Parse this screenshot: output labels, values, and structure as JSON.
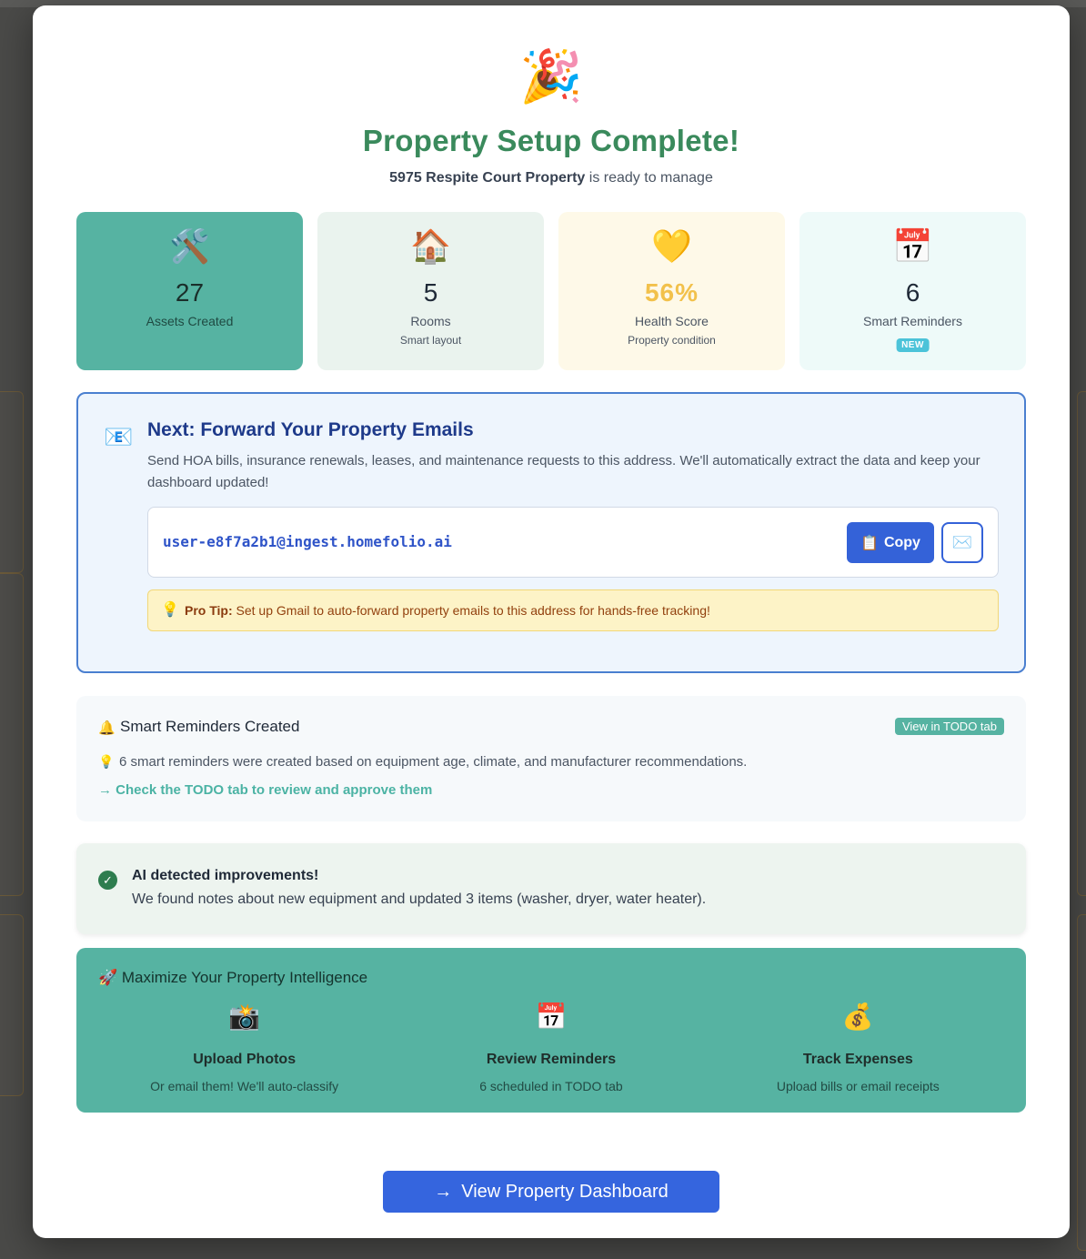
{
  "modal": {
    "icon": "🎉",
    "title": "Property Setup Complete!",
    "subtitle_property": "5975 Respite Court Property",
    "subtitle_suffix": " is ready to manage"
  },
  "stats": [
    {
      "icon": "🛠️",
      "value": "27",
      "label": "Assets Created",
      "sub": ""
    },
    {
      "icon": "🏠",
      "value": "5",
      "label": "Rooms",
      "sub": "Smart layout"
    },
    {
      "icon": "💛",
      "value": "56%",
      "label": "Health Score",
      "sub": "Property condition"
    },
    {
      "icon": "📅",
      "value": "6",
      "label": "Smart Reminders",
      "badge": "NEW"
    }
  ],
  "email_forward": {
    "icon": "📧",
    "title": "Next: Forward Your Property Emails",
    "description": "Send HOA bills, insurance renewals, leases, and maintenance requests to this address. We'll automatically extract the data and keep your dashboard updated!",
    "address": "user-e8f7a2b1@ingest.homefolio.ai",
    "copy_icon": "📋",
    "copy_label": "Copy",
    "mail_icon": "✉️",
    "tip_icon": "💡",
    "tip_bold": "Pro Tip:",
    "tip_text": " Set up Gmail to auto-forward property emails to this address for hands-free tracking!"
  },
  "reminders": {
    "bell_icon": "🔔",
    "title": "Smart Reminders Created",
    "view_button": "View in TODO tab",
    "bulb_icon": "💡",
    "description": "6 smart reminders were created based on equipment age, climate, and manufacturer recommendations.",
    "link": "→ Check the TODO tab to review and approve them"
  },
  "ai": {
    "check_icon": "✓",
    "title": "AI detected improvements!",
    "description": "We found notes about new equipment and updated 3 items (washer, dryer, water heater)."
  },
  "maximize": {
    "title": "🚀 Maximize Your Property Intelligence",
    "items": [
      {
        "icon": "📸",
        "label": "Upload Photos",
        "sub": "Or email them! We'll auto-classify"
      },
      {
        "icon": "📅",
        "label": "Review Reminders",
        "sub": "6 scheduled in TODO tab"
      },
      {
        "icon": "💰",
        "label": "Track Expenses",
        "sub": "Upload bills or email receipts"
      }
    ]
  },
  "dashboard_button": {
    "arrow": "→",
    "label": "View Property Dashboard"
  }
}
